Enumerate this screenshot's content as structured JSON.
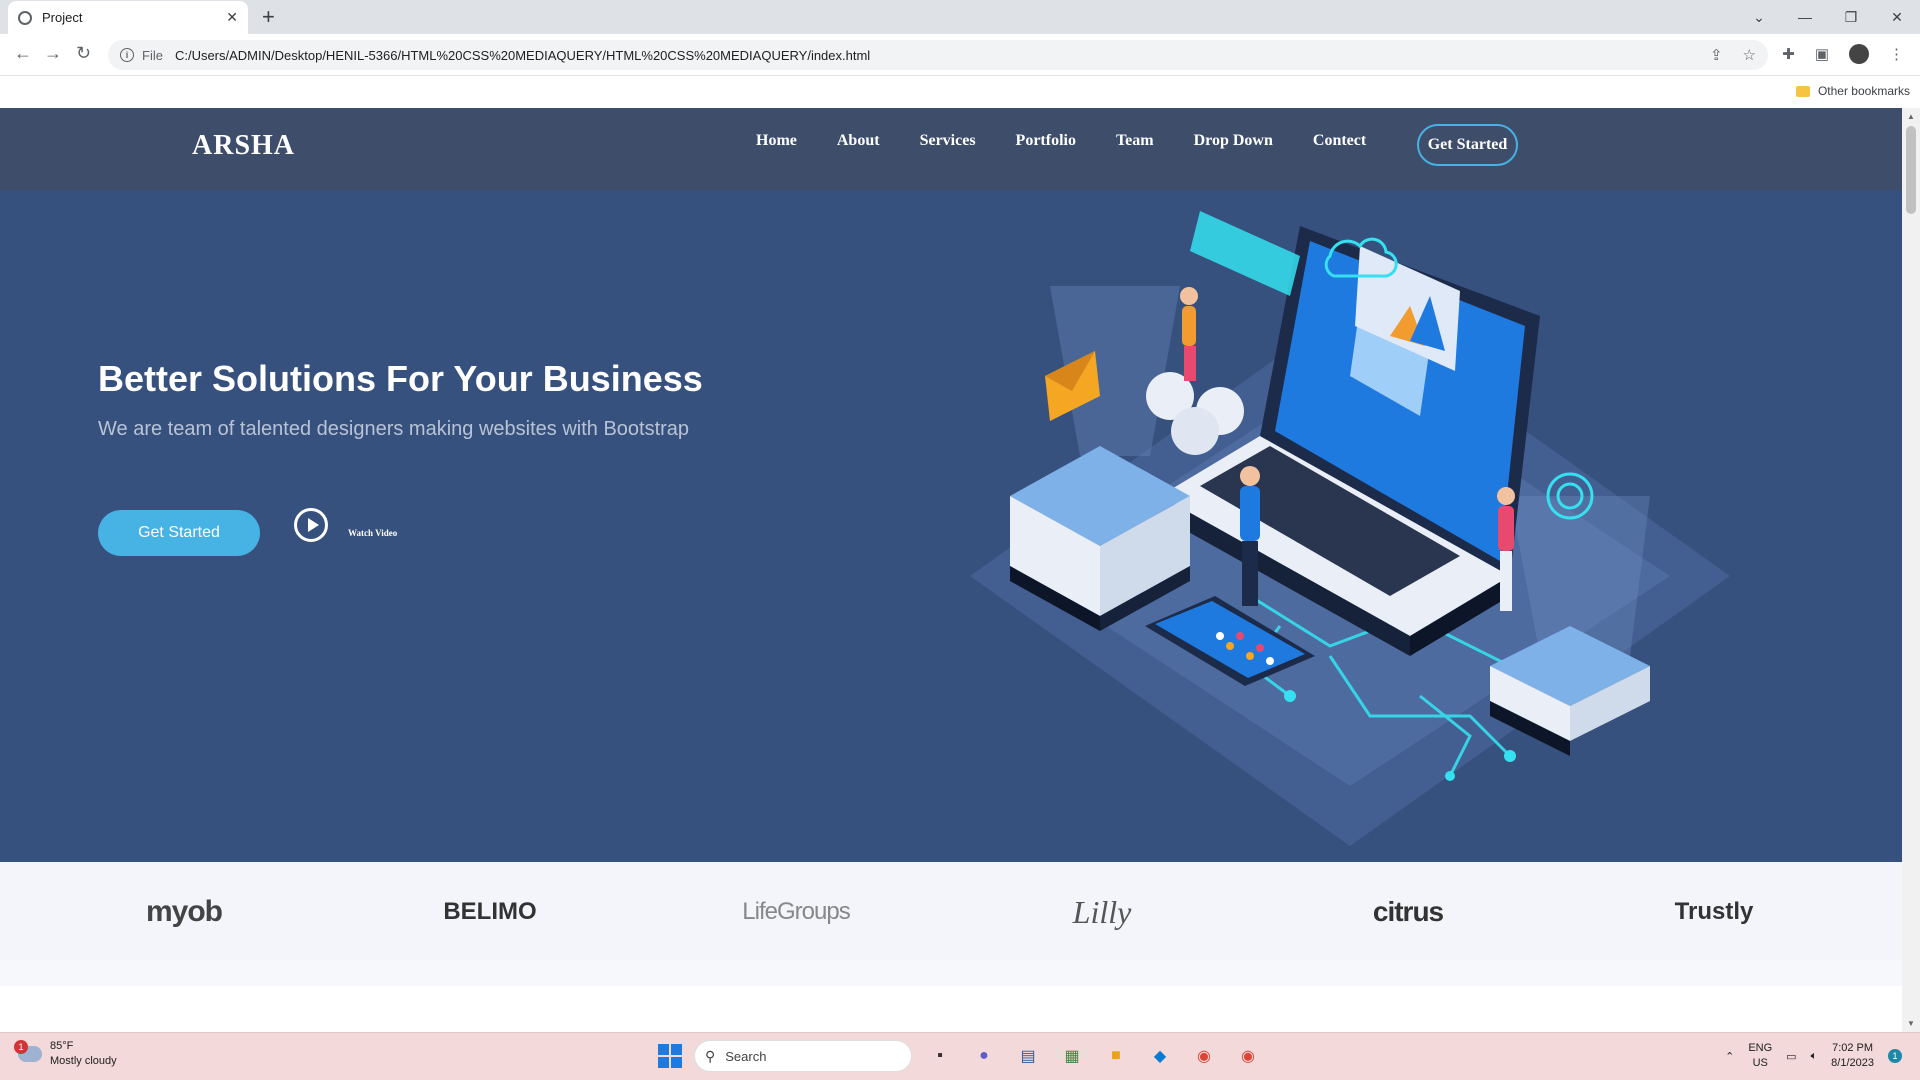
{
  "browser": {
    "tab_title": "Project",
    "address_scheme": "File",
    "url": "C:/Users/ADMIN/Desktop/HENIL-5366/HTML%20CSS%20MEDIAQUERY/HTML%20CSS%20MEDIAQUERY/index.html",
    "other_bookmarks": "Other bookmarks"
  },
  "site": {
    "logo": "ARSHA",
    "nav": [
      "Home",
      "About",
      "Services",
      "Portfolio",
      "Team",
      "Drop Down",
      "Contect"
    ],
    "nav_cta": "Get Started"
  },
  "hero": {
    "title": "Better Solutions For Your Business",
    "subtitle": "We are team of talented designers making websites with Bootstrap",
    "cta": "Get Started",
    "watch_video": "Watch Video"
  },
  "clients": [
    "myob",
    "BELIMO",
    "LifeGroups",
    "Lilly",
    "citrus",
    "Trustly"
  ],
  "taskbar": {
    "weather_temp": "85°F",
    "weather_desc": "Mostly cloudy",
    "weather_badge": "1",
    "search_placeholder": "Search",
    "lang_1": "ENG",
    "lang_2": "US",
    "time": "7:02 PM",
    "date": "8/1/2023",
    "notif_count": "1"
  },
  "colors": {
    "hero_bg": "#37517e",
    "header_bg": "#3d4d6a",
    "accent": "#47b2e4"
  }
}
